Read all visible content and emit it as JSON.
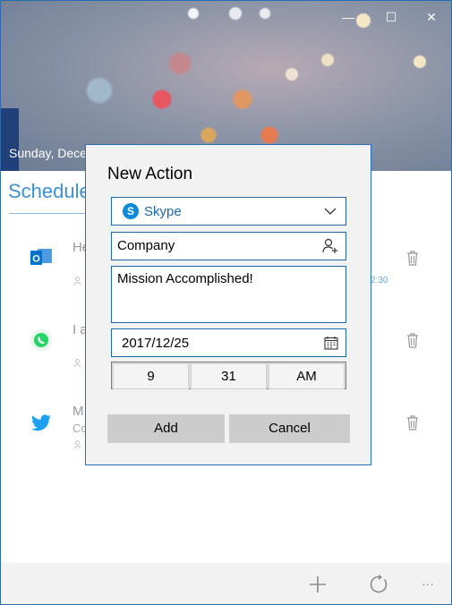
{
  "window": {
    "minimize_glyph": "—",
    "maximize_glyph": "☐",
    "close_glyph": "✕"
  },
  "header": {
    "date_text": "Sunday, Dece"
  },
  "schedule": {
    "title": "Schedule",
    "rows": [
      {
        "icon": "outlook-icon",
        "text": "He",
        "time": "2:30"
      },
      {
        "icon": "whatsapp-icon",
        "text": "I a"
      },
      {
        "icon": "twitter-icon",
        "text": "M",
        "sub": "Co"
      }
    ]
  },
  "dialog": {
    "title": "New Action",
    "service_select": {
      "value": "Skype",
      "icon": "skype-icon"
    },
    "contact_field": {
      "value": "Company",
      "icon": "add-contact-icon"
    },
    "message_field": {
      "value": "Mission Accomplished!"
    },
    "date_field": {
      "value": "2017/12/25",
      "icon": "calendar-icon"
    },
    "time_picker": {
      "hour": "9",
      "minute": "31",
      "period": "AM"
    },
    "add_label": "Add",
    "cancel_label": "Cancel"
  },
  "bottombar": {
    "icons": [
      "add-icon",
      "refresh-icon",
      "more-icon"
    ],
    "more_glyph": "···"
  },
  "colors": {
    "accent": "#1f67a8",
    "schedule_title": "#3f8fd0",
    "outlook": "#0072c6",
    "whatsapp": "#25d366",
    "twitter": "#1da1f2",
    "skype": "#0a8ad8"
  }
}
